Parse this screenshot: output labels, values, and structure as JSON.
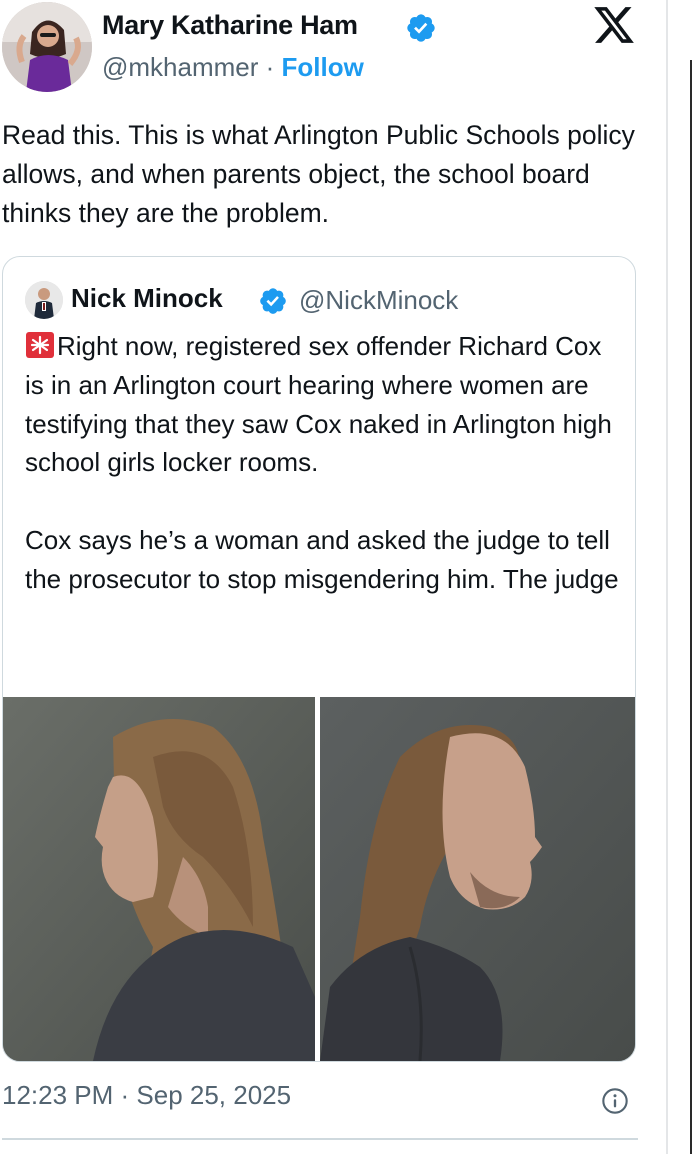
{
  "author": {
    "name": "Mary Katharine Ham",
    "handle": "@mkhammer",
    "separator": " · ",
    "follow_label": "Follow",
    "verified": true
  },
  "brand": {
    "logo_icon": "x-logo-icon"
  },
  "tweet": {
    "text": "Read this. This is what Arlington Public Schools policy allows, and when parents object, the school board thinks they are the problem.",
    "timestamp": "12:23 PM · Sep 25, 2025",
    "info_icon": "info-icon"
  },
  "quote": {
    "name": "Nick Minock",
    "handle": "@NickMinock",
    "verified": true,
    "emoji": "siren-emoji",
    "paragraph1": "Right now, registered sex offender Richard Cox is in an Arlington court hearing where women are testifying that they saw Cox naked in Arlington high school girls locker rooms.",
    "paragraph2": "Cox says he’s a woman and asked the judge to tell the prosecutor to stop misgendering him. The judge",
    "photos": [
      {
        "name": "mugshot-profile-left"
      },
      {
        "name": "mugshot-profile-right"
      }
    ]
  },
  "colors": {
    "accent": "#1d9bf0",
    "text_primary": "#0f1419",
    "text_secondary": "#536471",
    "border": "#cfd9de"
  }
}
